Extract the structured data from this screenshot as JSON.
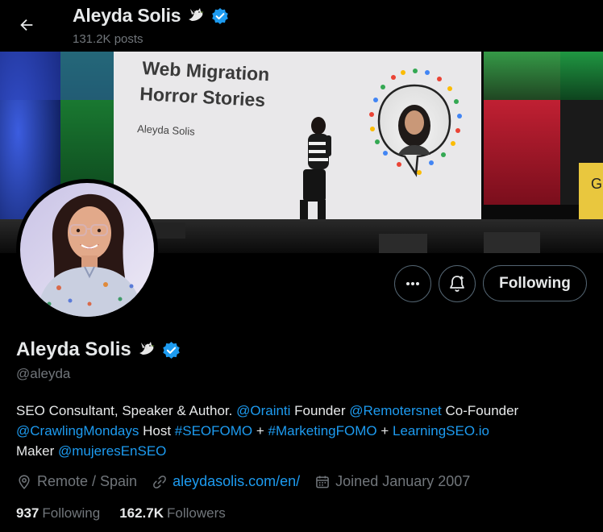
{
  "header": {
    "name": "Aleyda Solis",
    "posts": "131.2K posts"
  },
  "banner": {
    "slide_title_line1": "Web Migration",
    "slide_title_line2": "Horror Stories",
    "slide_author": "Aleyda Solis",
    "podium_letter": "G"
  },
  "actions": {
    "following_label": "Following"
  },
  "profile": {
    "name": "Aleyda Solis",
    "handle": "@aleyda",
    "bio": {
      "t1": "SEO Consultant, Speaker & Author. ",
      "l1": "@Orainti",
      "t2": " Founder ",
      "l2": "@Remotersnet",
      "t3": " Co-Founder",
      "l3": "@CrawlingMondays",
      "t4": " Host ",
      "l4": "#SEOFOMO",
      "t5": " + ",
      "l5": "#MarketingFOMO",
      "t6": " + ",
      "l6": "LearningSEO.io",
      "t7": "Maker ",
      "l7": "@mujeresEnSEO"
    },
    "location": "Remote / Spain",
    "website": "aleydasolis.com/en/",
    "joined": "Joined January 2007",
    "following_count": "937",
    "following_label": "Following",
    "followers_count": "162.7K",
    "followers_label": "Followers"
  },
  "colors": {
    "accent": "#1d9bf0",
    "muted": "#71767b",
    "background": "#000000"
  }
}
